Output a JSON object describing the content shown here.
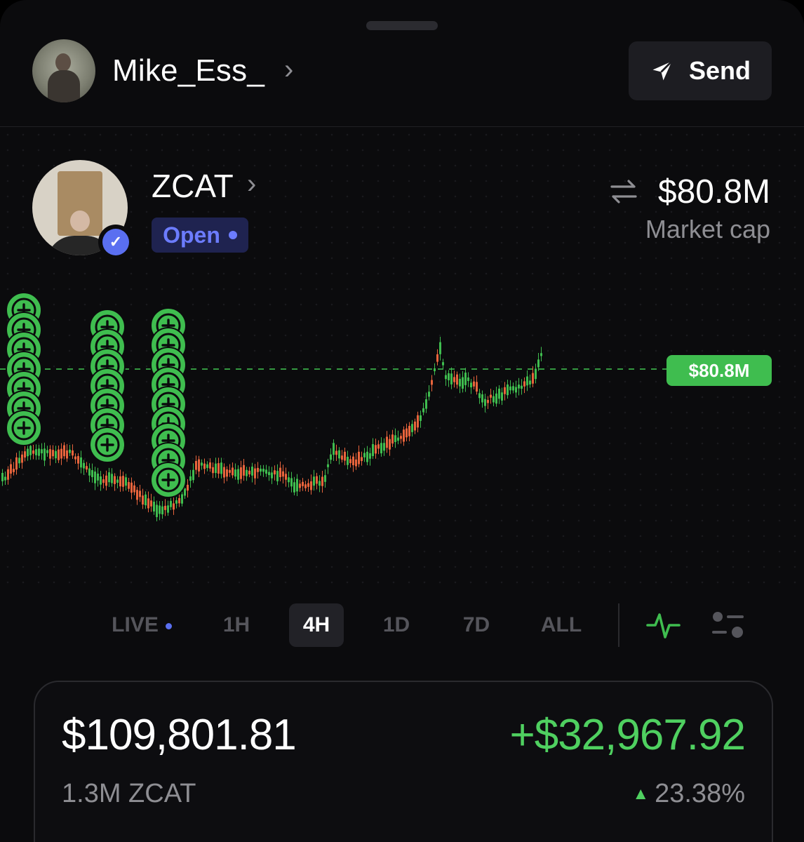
{
  "user": {
    "username": "Mike_Ess_"
  },
  "send_button": {
    "label": "Send"
  },
  "token": {
    "name": "ZCAT",
    "status": "Open",
    "market_cap": "$80.8M",
    "market_cap_label": "Market cap",
    "current_price_tag": "$80.8M"
  },
  "timeframes": {
    "live": "LIVE",
    "h1": "1H",
    "h4": "4H",
    "d1": "1D",
    "d7": "7D",
    "all": "ALL",
    "selected": "4H"
  },
  "holding": {
    "value": "$109,801.81",
    "pnl": "+$32,967.92",
    "amount": "1.3M ZCAT",
    "pct": "23.38%"
  },
  "colors": {
    "up": "#3fbd4f",
    "down": "#e8643c",
    "accent": "#5a6ff0"
  },
  "icons": {
    "send": "paper-plane-icon",
    "swap": "swap-arrows-icon",
    "verified": "verified-badge-icon",
    "line_chart": "line-chart-icon",
    "candle_settings": "candle-settings-icon",
    "buy_marker": "plus-circle-icon"
  }
}
